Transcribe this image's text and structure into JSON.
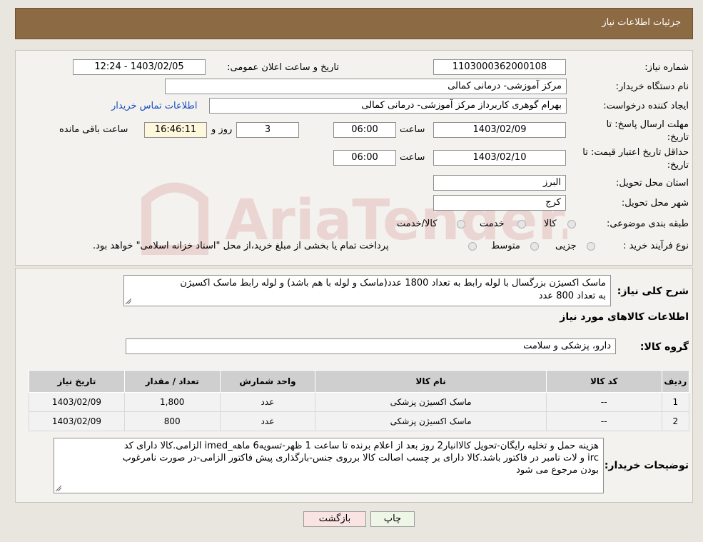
{
  "header": {
    "title": "جزئیات اطلاعات نیاز"
  },
  "form": {
    "need_number": {
      "label": "شماره نیاز:",
      "value": "1103000362000108"
    },
    "announce": {
      "label": "تاریخ و ساعت اعلان عمومی:",
      "value": "1403/02/05 - 12:24"
    },
    "buyer_org": {
      "label": "نام دستگاه خریدار:",
      "value": "مرکز آموزشی- درمانی کمالی"
    },
    "requester": {
      "label": "ایجاد کننده درخواست:",
      "value": "بهرام گوهری کاربرداز مرکز آموزشی- درمانی کمالی",
      "contact_link": "اطلاعات تماس خریدار"
    },
    "reply_deadline": {
      "label_line1": "مهلت ارسال پاسخ: تا",
      "label_line2": "تاریخ:",
      "date": "1403/02/09",
      "time_label": "ساعت",
      "time": "06:00",
      "days": "3",
      "days_label": "روز و",
      "remaining": "16:46:11",
      "remaining_label": "ساعت باقی مانده"
    },
    "price_validity": {
      "label_line1": "حداقل تاریخ اعتبار قیمت: تا",
      "label_line2": "تاریخ:",
      "date": "1403/02/10",
      "time_label": "ساعت",
      "time": "06:00"
    },
    "province": {
      "label": "استان محل تحویل:",
      "value": "البرز"
    },
    "city": {
      "label": "شهر محل تحویل:",
      "value": "کرج"
    },
    "category": {
      "label": "طبقه بندی موضوعی:",
      "options": [
        "کالا",
        "خدمت",
        "کالا/خدمت"
      ]
    },
    "process_type": {
      "label": "نوع فرآیند خرید :",
      "options": [
        "جزیی",
        "متوسط"
      ],
      "note": "پرداخت تمام یا بخشی از مبلغ خرید،از محل \"اسناد خزانه اسلامی\" خواهد بود."
    }
  },
  "details": {
    "summary_label": "شرح کلی نیاز:",
    "summary_line1": "ماسک اکسیژن بزرگسال با لوله رابط به تعداد 1800 عدد(ماسک و لوله با هم باشد) و لوله رابط ماسک اکسیژن",
    "summary_line2": "به تعداد 800 عدد",
    "goods_info_title": "اطلاعات کالاهای مورد نیاز",
    "goods_group_label": "گروه کالا:",
    "goods_group_value": "دارو، پزشکی و سلامت",
    "table": {
      "headers": [
        "ردیف",
        "کد کالا",
        "نام کالا",
        "واحد شمارش",
        "تعداد / مقدار",
        "تاریخ نیاز"
      ],
      "rows": [
        [
          "1",
          "--",
          "ماسک اکسیژن پزشکی",
          "عدد",
          "1,800",
          "1403/02/09"
        ],
        [
          "2",
          "--",
          "ماسک اکسیژن پزشکی",
          "عدد",
          "800",
          "1403/02/09"
        ]
      ]
    },
    "buyer_notes_label": "توضیحات خریدار:",
    "buyer_notes_line1": "هزینه حمل و تخلیه رایگان-تحویل کالاانبار2 روز بعد از اعلام برنده تا ساعت 1 ظهر-تسویه6 ماهه_imed الزامی.کالا دارای کد",
    "buyer_notes_line2": "irc و لات نامبر در فاکتور باشد.کالا دارای بر چسب اصالت کالا برروی جنس-بارگذاری پیش فاکتور الزامی-در صورت نامرغوب",
    "buyer_notes_line3": "بودن مرجوع می شود"
  },
  "buttons": {
    "print": "چاپ",
    "back": "بازگشت"
  },
  "watermark": {
    "text": "AriaTender.neT"
  }
}
